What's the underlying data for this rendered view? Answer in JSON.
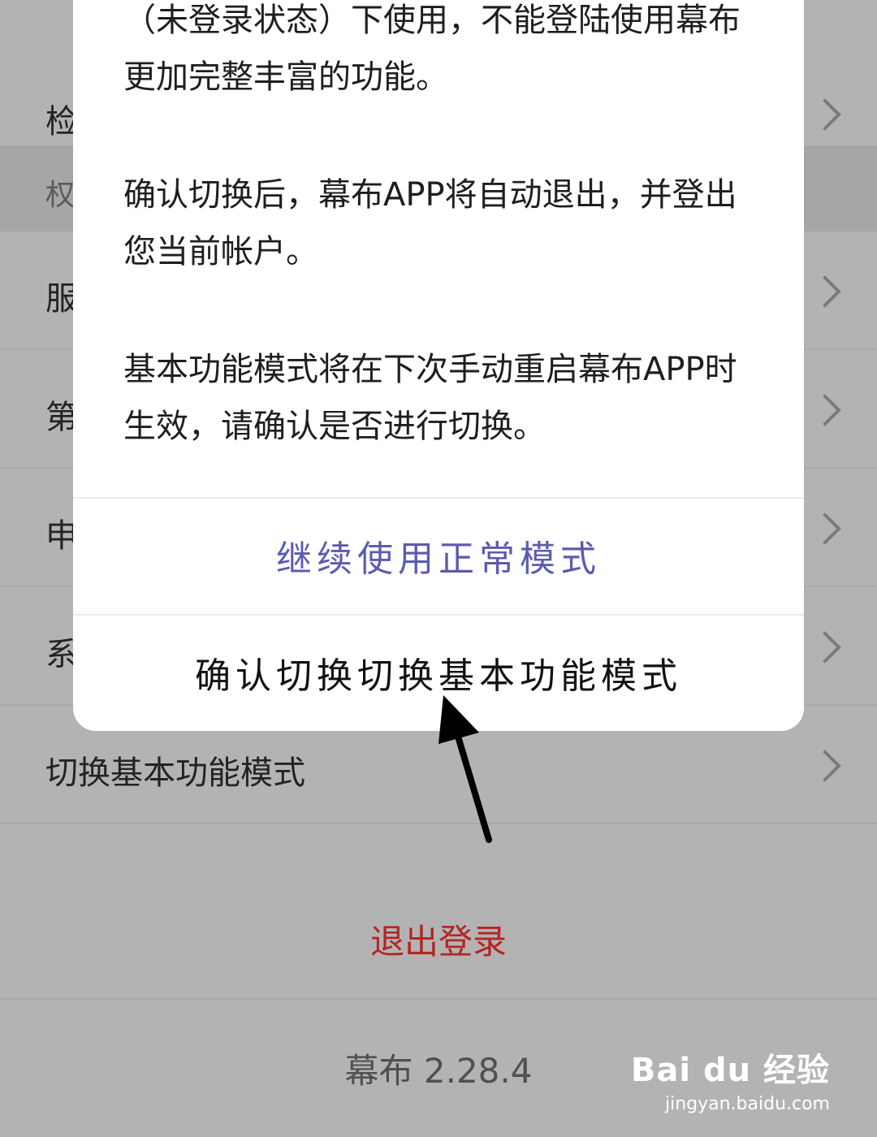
{
  "settings": {
    "rows": [
      {
        "label": "检",
        "chevron": "chevron-right-icon"
      },
      {
        "label": "服",
        "chevron": "chevron-right-icon"
      },
      {
        "label": "第",
        "chevron": "chevron-right-icon"
      },
      {
        "label": "申",
        "chevron": "chevron-right-icon"
      },
      {
        "label": "系",
        "chevron": "chevron-right-icon"
      },
      {
        "label": "切换基本功能模式",
        "chevron": "chevron-right-icon"
      }
    ],
    "section_header": "权",
    "logout_label": "退出登录",
    "version_text": "幕布 2.28.4"
  },
  "dialog": {
    "paragraphs": [
      "（未登录状态）下使用，不能登陆使用幕布更加完整丰富的功能。",
      "确认切换后，幕布APP将自动退出，并登出您当前帐户。",
      "基本功能模式将在下次手动重启幕布APP时生效，请确认是否进行切换。"
    ],
    "continue_label": "继续使用正常模式",
    "confirm_label": "确认切换切换基本功能模式"
  },
  "watermark": {
    "brand": "Bai du 经验",
    "site": "jingyan.baidu.com"
  },
  "colors": {
    "logout": "#b52424",
    "continue": "#5b5bb0"
  }
}
